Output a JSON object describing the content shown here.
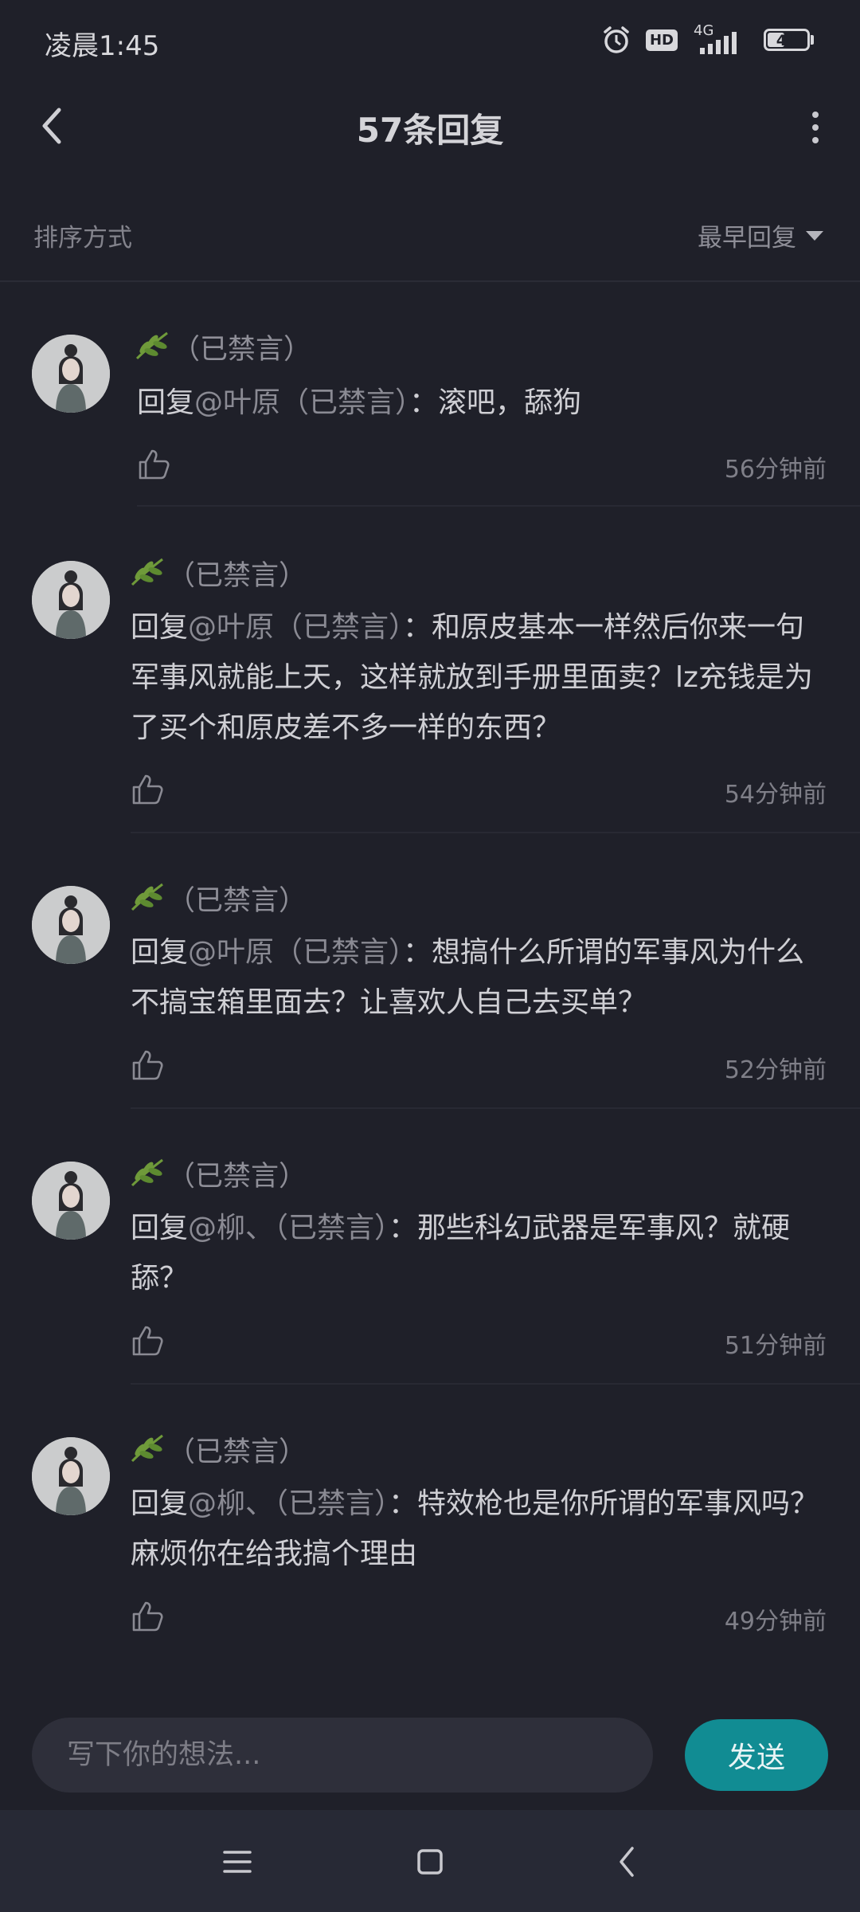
{
  "status": {
    "time": "凌晨1:45",
    "network": "4G",
    "battery": "44",
    "battery_level": 0.44,
    "hd": "HD"
  },
  "header": {
    "title": "57条回复"
  },
  "sort": {
    "label": "排序方式",
    "selected": "最早回复"
  },
  "replies": [
    {
      "user": "（已禁言）",
      "prefix": "回复",
      "mention": "@叶原（已禁言）",
      "text": "：滚吧，舔狗",
      "time": "56分钟前"
    },
    {
      "user": "（已禁言）",
      "prefix": "回复",
      "mention": "@叶原（已禁言）",
      "text": "：和原皮基本一样然后你来一句军事风就能上天，这样就放到手册里面卖？lz充钱是为了买个和原皮差不多一样的东西？",
      "time": "54分钟前"
    },
    {
      "user": "（已禁言）",
      "prefix": "回复",
      "mention": "@叶原（已禁言）",
      "text": "：想搞什么所谓的军事风为什么不搞宝箱里面去？让喜欢人自己去买单？",
      "time": "52分钟前"
    },
    {
      "user": "（已禁言）",
      "prefix": "回复",
      "mention": "@柳、（已禁言）",
      "text": "：那些科幻武器是军事风？就硬舔？",
      "time": "51分钟前"
    },
    {
      "user": "（已禁言）",
      "prefix": "回复",
      "mention": "@柳、（已禁言）",
      "text": "：特效枪也是你所谓的军事风吗？麻烦你在给我搞个理由",
      "time": "49分钟前"
    }
  ],
  "composer": {
    "placeholder": "写下你的想法...",
    "send_label": "发送"
  },
  "colors": {
    "accent": "#118c93",
    "background": "#1f2029",
    "leaf": "#6f9a3a"
  }
}
